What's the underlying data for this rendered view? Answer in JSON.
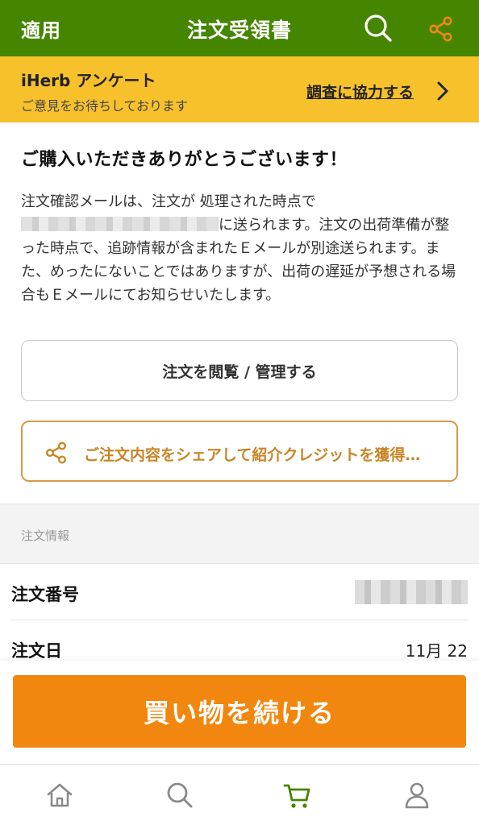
{
  "colors": {
    "header_bg": "#458500",
    "survey_bg": "#f7c12c",
    "share_accent": "#c98525",
    "cta_bg": "#f2870f",
    "cart_active": "#458500"
  },
  "header": {
    "apply_label": "適用",
    "title": "注文受領書",
    "search_icon": "search-icon",
    "share_icon": "share-icon"
  },
  "survey": {
    "title": "iHerb アンケート",
    "subtitle": "ご意見をお待ちしております",
    "link": "調査に協力する",
    "chevron_icon": "chevron-right-icon"
  },
  "confirmation": {
    "heading": "ご購入いただきありがとうございます！",
    "text_line1": "注文確認メールは、注文が 処理された時点で",
    "text_after_email": "に送られます。注文の出荷準備が整った時点で、追跡情報が含まれたＥメールが別途送られます。また、めったにないことではありますが、出荷の遅延が予想される場合もＥメールにてお知らせいたします。"
  },
  "buttons": {
    "manage": "注文を閲覧 / 管理する",
    "share_referral": "ご注文内容をシェアして紹介クレジットを獲得…",
    "continue_shopping": "買い物を続ける"
  },
  "order_info": {
    "section_label": "注文情報",
    "order_number_label": "注文番号",
    "order_date_label": "注文日",
    "order_date_value": "11月 22"
  },
  "tabbar": {
    "items": [
      {
        "icon": "home-icon",
        "active": false
      },
      {
        "icon": "search-icon",
        "active": false
      },
      {
        "icon": "cart-icon",
        "active": true
      },
      {
        "icon": "user-icon",
        "active": false
      }
    ]
  }
}
